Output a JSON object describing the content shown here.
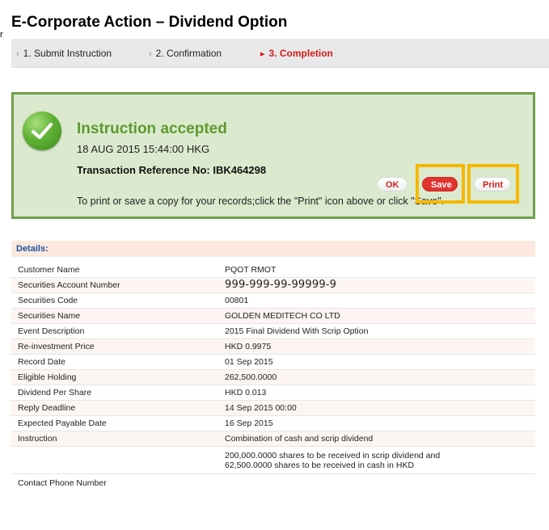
{
  "page": {
    "title": "E-Corporate Action – Dividend Option",
    "stray_char": "r"
  },
  "steps": [
    {
      "label": "1. Submit Instruction",
      "active": false
    },
    {
      "label": "2. Confirmation",
      "active": false
    },
    {
      "label": "3. Completion",
      "active": true
    }
  ],
  "result": {
    "title": "Instruction accepted",
    "timestamp": "18 AUG 2015 15:44:00 HKG",
    "transaction_ref": "Transaction Reference No: IBK464298",
    "message": "To print or save a copy for your records;click the \"Print\" icon above or click \"Save\".",
    "buttons": {
      "ok": "OK",
      "save": "Save",
      "print": "Print"
    },
    "icon": "check-circle-icon"
  },
  "details": {
    "header": "Details:",
    "rows": [
      {
        "label": "Customer Name",
        "value": "PQOT RMOT"
      },
      {
        "label": "Securities Account Number",
        "value": "999-999-99-99999-9"
      },
      {
        "label": "Securities Code",
        "value": "00801"
      },
      {
        "label": "Securities Name",
        "value": "GOLDEN MEDITECH CO LTD"
      },
      {
        "label": "Event Description",
        "value": "2015 Final Dividend With Scrip Option"
      },
      {
        "label": "Re-investment Price",
        "value": "HKD 0.9975"
      },
      {
        "label": "Record Date",
        "value": "01 Sep 2015"
      },
      {
        "label": "Eligible Holding",
        "value": "262,500.0000"
      },
      {
        "label": "Dividend Per Share",
        "value": "HKD 0.013"
      },
      {
        "label": "Reply Deadline",
        "value": "14 Sep 2015 00:00"
      },
      {
        "label": "Expected Payable Date",
        "value": "16 Sep 2015"
      },
      {
        "label": "Instruction",
        "value": "Combination of cash and scrip dividend"
      },
      {
        "label": "",
        "value_line1": "200,000.0000 shares to be received in scrip dividend and",
        "value_line2": "62,500.0000 shares to be received in cash in HKD"
      },
      {
        "label": "Contact Phone Number",
        "value": ""
      }
    ]
  },
  "colors": {
    "accent_green": "#5c9a2e",
    "box_border": "#6da04a",
    "box_bg": "#dbeace",
    "active_step": "#d61a1a",
    "highlight": "#f5b800",
    "details_header_text": "#1a55a0"
  }
}
